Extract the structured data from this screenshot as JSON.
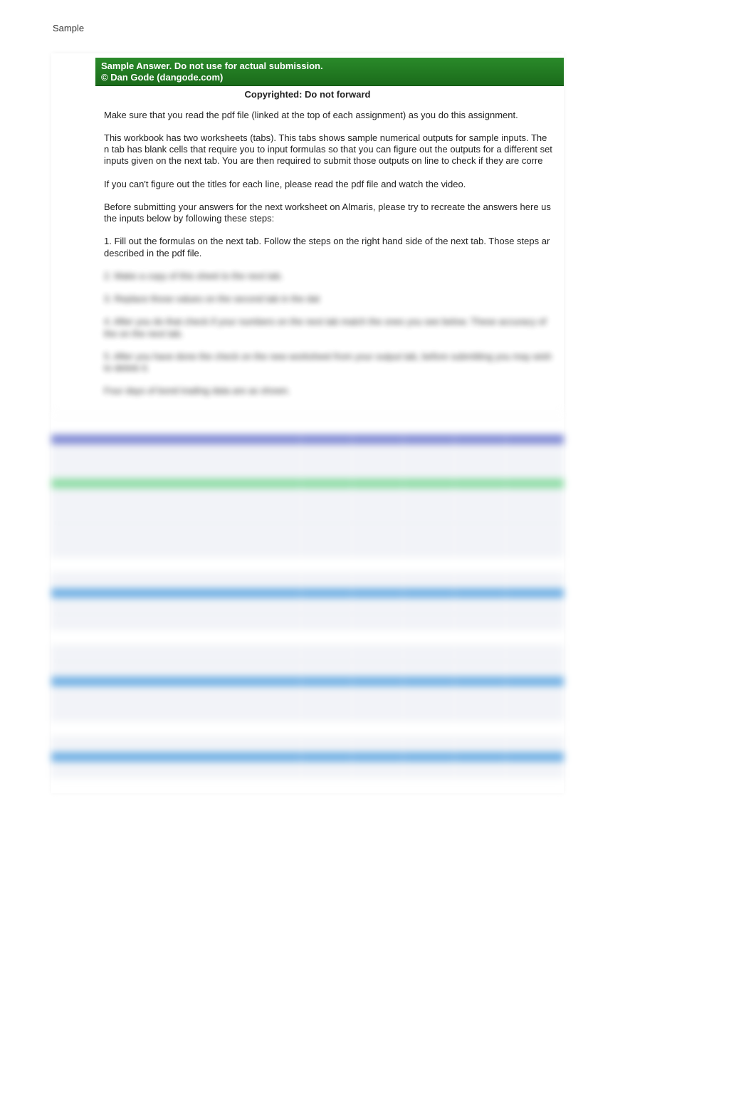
{
  "page_label": "Sample",
  "header": {
    "line1": "Sample Answer. Do not use for actual submission.",
    "line2": "© Dan Gode (dangode.com)",
    "sub": "Copyrighted: Do not forward"
  },
  "paragraphs": [
    "Make sure that you read the pdf file (linked at the top of each assignment) as you do this assignment.",
    "This workbook has two worksheets (tabs). This tabs shows sample numerical outputs for sample inputs. The n tab has blank cells that require you to input formulas so that you can figure out the outputs for a different set inputs given on the next tab.  You are then required to submit those outputs on line to check if they are corre",
    "If you can't figure out the titles for each line, please read the pdf file and watch the video.",
    "Before submitting your answers for the next worksheet on Almaris, please try to recreate the answers here us the inputs below by following these steps:",
    "1. Fill out the formulas on the next tab. Follow the steps on the right hand side of the next tab. Those steps ar described in the pdf file."
  ],
  "blurred_paragraphs": [
    "2. Make a copy of this sheet to the next tab.",
    "3. Replace those values on the second tab in the dat",
    "4. After you do that check if your numbers on the next tab match the ones you see below.  These accuracy of the on the next tab.",
    "5. After you have done the check on the new worksheet from your output tab, before submitting you may wish to delete it.",
    "Four days of bond trading data are as shown."
  ],
  "sheet_bands": [
    {
      "type": "h",
      "cls": "band-white"
    },
    {
      "type": "row",
      "cls": "band-white",
      "cols": 5
    },
    {
      "type": "row",
      "cls": "band-purple",
      "cols": 5,
      "short": true
    },
    {
      "type": "tall",
      "cls": "band-lt",
      "cols": 5
    },
    {
      "type": "row",
      "cls": "band-green",
      "cols": 5,
      "short": true
    },
    {
      "type": "tall",
      "cls": "band-lt",
      "cols": 5
    },
    {
      "type": "tall",
      "cls": "band-lt",
      "cols": 5
    },
    {
      "type": "row",
      "cls": "band-white",
      "cols": 5
    },
    {
      "type": "row",
      "cls": "band-lt",
      "cols": 5
    },
    {
      "type": "row",
      "cls": "band-blue",
      "cols": 5,
      "short": true
    },
    {
      "type": "row",
      "cls": "band-lt",
      "cols": 5
    },
    {
      "type": "row",
      "cls": "band-lt",
      "cols": 5
    },
    {
      "type": "row",
      "cls": "band-white",
      "cols": 5
    },
    {
      "type": "row",
      "cls": "band-lt",
      "cols": 5
    },
    {
      "type": "row",
      "cls": "band-lt",
      "cols": 5
    },
    {
      "type": "row",
      "cls": "band-blue",
      "cols": 5,
      "short": true
    },
    {
      "type": "tall",
      "cls": "band-lt",
      "cols": 5
    },
    {
      "type": "row",
      "cls": "band-white",
      "cols": 5
    },
    {
      "type": "row",
      "cls": "band-lt",
      "cols": 5
    },
    {
      "type": "row",
      "cls": "band-blue",
      "cols": 5,
      "short": true
    },
    {
      "type": "row",
      "cls": "band-lt",
      "cols": 5
    },
    {
      "type": "row",
      "cls": "band-white",
      "cols": 5
    }
  ]
}
